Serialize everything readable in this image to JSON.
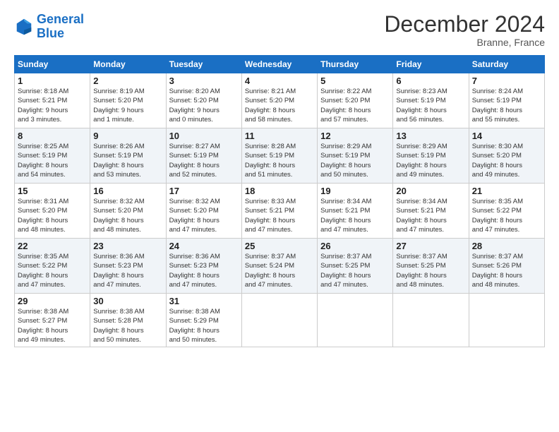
{
  "header": {
    "logo_line1": "General",
    "logo_line2": "Blue",
    "month": "December 2024",
    "location": "Branne, France"
  },
  "weekdays": [
    "Sunday",
    "Monday",
    "Tuesday",
    "Wednesday",
    "Thursday",
    "Friday",
    "Saturday"
  ],
  "weeks": [
    [
      {
        "day": "1",
        "info": "Sunrise: 8:18 AM\nSunset: 5:21 PM\nDaylight: 9 hours\nand 3 minutes."
      },
      {
        "day": "2",
        "info": "Sunrise: 8:19 AM\nSunset: 5:20 PM\nDaylight: 9 hours\nand 1 minute."
      },
      {
        "day": "3",
        "info": "Sunrise: 8:20 AM\nSunset: 5:20 PM\nDaylight: 9 hours\nand 0 minutes."
      },
      {
        "day": "4",
        "info": "Sunrise: 8:21 AM\nSunset: 5:20 PM\nDaylight: 8 hours\nand 58 minutes."
      },
      {
        "day": "5",
        "info": "Sunrise: 8:22 AM\nSunset: 5:20 PM\nDaylight: 8 hours\nand 57 minutes."
      },
      {
        "day": "6",
        "info": "Sunrise: 8:23 AM\nSunset: 5:19 PM\nDaylight: 8 hours\nand 56 minutes."
      },
      {
        "day": "7",
        "info": "Sunrise: 8:24 AM\nSunset: 5:19 PM\nDaylight: 8 hours\nand 55 minutes."
      }
    ],
    [
      {
        "day": "8",
        "info": "Sunrise: 8:25 AM\nSunset: 5:19 PM\nDaylight: 8 hours\nand 54 minutes."
      },
      {
        "day": "9",
        "info": "Sunrise: 8:26 AM\nSunset: 5:19 PM\nDaylight: 8 hours\nand 53 minutes."
      },
      {
        "day": "10",
        "info": "Sunrise: 8:27 AM\nSunset: 5:19 PM\nDaylight: 8 hours\nand 52 minutes."
      },
      {
        "day": "11",
        "info": "Sunrise: 8:28 AM\nSunset: 5:19 PM\nDaylight: 8 hours\nand 51 minutes."
      },
      {
        "day": "12",
        "info": "Sunrise: 8:29 AM\nSunset: 5:19 PM\nDaylight: 8 hours\nand 50 minutes."
      },
      {
        "day": "13",
        "info": "Sunrise: 8:29 AM\nSunset: 5:19 PM\nDaylight: 8 hours\nand 49 minutes."
      },
      {
        "day": "14",
        "info": "Sunrise: 8:30 AM\nSunset: 5:20 PM\nDaylight: 8 hours\nand 49 minutes."
      }
    ],
    [
      {
        "day": "15",
        "info": "Sunrise: 8:31 AM\nSunset: 5:20 PM\nDaylight: 8 hours\nand 48 minutes."
      },
      {
        "day": "16",
        "info": "Sunrise: 8:32 AM\nSunset: 5:20 PM\nDaylight: 8 hours\nand 48 minutes."
      },
      {
        "day": "17",
        "info": "Sunrise: 8:32 AM\nSunset: 5:20 PM\nDaylight: 8 hours\nand 47 minutes."
      },
      {
        "day": "18",
        "info": "Sunrise: 8:33 AM\nSunset: 5:21 PM\nDaylight: 8 hours\nand 47 minutes."
      },
      {
        "day": "19",
        "info": "Sunrise: 8:34 AM\nSunset: 5:21 PM\nDaylight: 8 hours\nand 47 minutes."
      },
      {
        "day": "20",
        "info": "Sunrise: 8:34 AM\nSunset: 5:21 PM\nDaylight: 8 hours\nand 47 minutes."
      },
      {
        "day": "21",
        "info": "Sunrise: 8:35 AM\nSunset: 5:22 PM\nDaylight: 8 hours\nand 47 minutes."
      }
    ],
    [
      {
        "day": "22",
        "info": "Sunrise: 8:35 AM\nSunset: 5:22 PM\nDaylight: 8 hours\nand 47 minutes."
      },
      {
        "day": "23",
        "info": "Sunrise: 8:36 AM\nSunset: 5:23 PM\nDaylight: 8 hours\nand 47 minutes."
      },
      {
        "day": "24",
        "info": "Sunrise: 8:36 AM\nSunset: 5:23 PM\nDaylight: 8 hours\nand 47 minutes."
      },
      {
        "day": "25",
        "info": "Sunrise: 8:37 AM\nSunset: 5:24 PM\nDaylight: 8 hours\nand 47 minutes."
      },
      {
        "day": "26",
        "info": "Sunrise: 8:37 AM\nSunset: 5:25 PM\nDaylight: 8 hours\nand 47 minutes."
      },
      {
        "day": "27",
        "info": "Sunrise: 8:37 AM\nSunset: 5:25 PM\nDaylight: 8 hours\nand 48 minutes."
      },
      {
        "day": "28",
        "info": "Sunrise: 8:37 AM\nSunset: 5:26 PM\nDaylight: 8 hours\nand 48 minutes."
      }
    ],
    [
      {
        "day": "29",
        "info": "Sunrise: 8:38 AM\nSunset: 5:27 PM\nDaylight: 8 hours\nand 49 minutes."
      },
      {
        "day": "30",
        "info": "Sunrise: 8:38 AM\nSunset: 5:28 PM\nDaylight: 8 hours\nand 50 minutes."
      },
      {
        "day": "31",
        "info": "Sunrise: 8:38 AM\nSunset: 5:29 PM\nDaylight: 8 hours\nand 50 minutes."
      },
      {
        "day": "",
        "info": ""
      },
      {
        "day": "",
        "info": ""
      },
      {
        "day": "",
        "info": ""
      },
      {
        "day": "",
        "info": ""
      }
    ]
  ]
}
